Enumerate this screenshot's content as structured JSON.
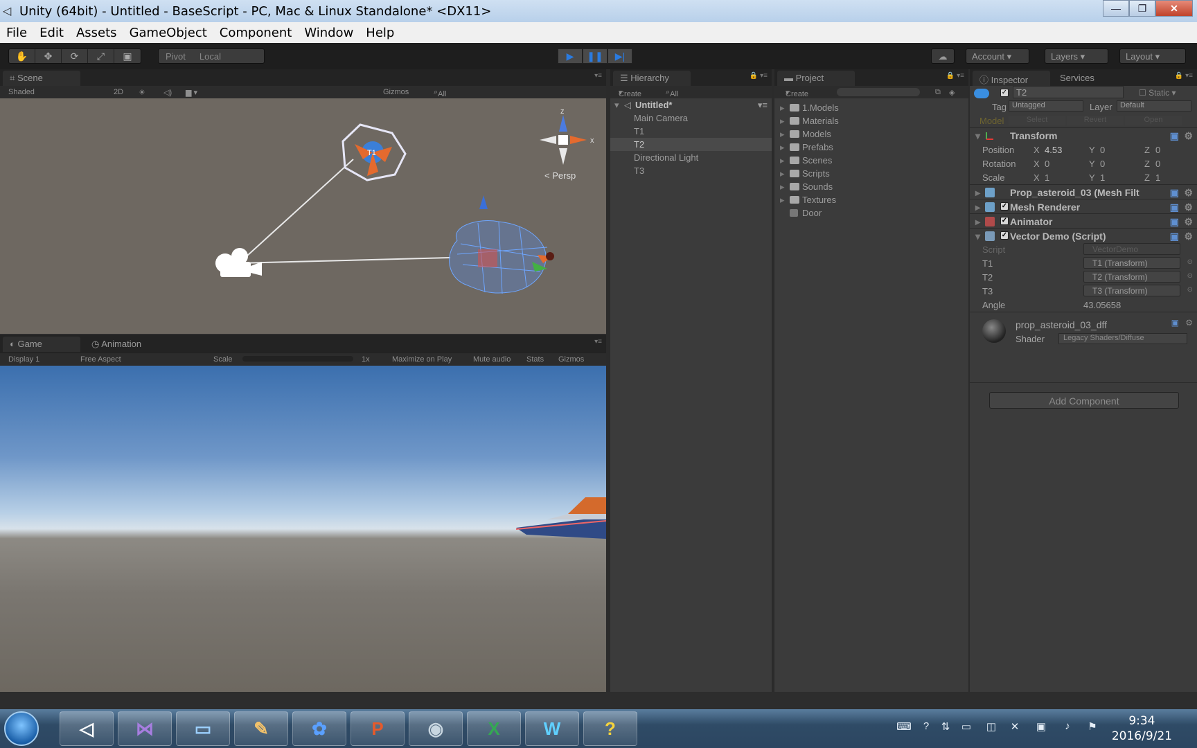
{
  "window": {
    "title": "Unity (64bit) - Untitled - BaseScript - PC, Mac & Linux Standalone* <DX11>",
    "minimize": "—",
    "maximize": "❐",
    "close": "✕"
  },
  "menu": [
    "File",
    "Edit",
    "Assets",
    "GameObject",
    "Component",
    "Window",
    "Help"
  ],
  "toolbar": {
    "pivot": "Pivot",
    "local": "Local",
    "account": "Account",
    "layers": "Layers",
    "layout": "Layout"
  },
  "scene": {
    "tab": "Scene",
    "shading": "Shaded",
    "mode_2d": "2D",
    "gizmos": "Gizmos",
    "search": "All",
    "persp": "Persp",
    "label_t1": "T1",
    "axis_z": "z",
    "axis_x": "x"
  },
  "game": {
    "tab": "Game",
    "tab2": "Animation",
    "display": "Display 1",
    "aspect": "Free Aspect",
    "scale_label": "Scale",
    "scale_value": "1x",
    "maximize": "Maximize on Play",
    "mute": "Mute audio",
    "stats": "Stats",
    "gizmos": "Gizmos"
  },
  "hierarchy": {
    "tab": "Hierarchy",
    "create": "Create",
    "search": "All",
    "scene_name": "Untitled*",
    "items": [
      "Main Camera",
      "T1",
      "T2",
      "Directional Light",
      "T3"
    ],
    "selected_index": 2
  },
  "project": {
    "tab": "Project",
    "create": "Create",
    "folders": [
      "1.Models",
      "Materials",
      "Models",
      "Prefabs",
      "Scenes",
      "Scripts",
      "Sounds",
      "Textures"
    ],
    "asset": "Door"
  },
  "inspector": {
    "tab": "Inspector",
    "tab2": "Services",
    "object_name": "T2",
    "static": "Static",
    "tag_label": "Tag",
    "tag_value": "Untagged",
    "layer_label": "Layer",
    "layer_value": "Default",
    "model_label": "Model",
    "model_select": "Select",
    "model_revert": "Revert",
    "model_open": "Open",
    "transform": {
      "title": "Transform",
      "position": {
        "label": "Position",
        "x": "4.53",
        "y": "0",
        "z": "0"
      },
      "rotation": {
        "label": "Rotation",
        "x": "0",
        "y": "0",
        "z": "0"
      },
      "scale": {
        "label": "Scale",
        "x": "1",
        "y": "1",
        "z": "1"
      }
    },
    "mesh_filter": "Prop_asteroid_03 (Mesh Filt",
    "mesh_renderer": "Mesh Renderer",
    "animator": "Animator",
    "script": {
      "title": "Vector Demo (Script)",
      "script_label": "Script",
      "script_value": "VectorDemo",
      "t1_label": "T1",
      "t1_value": "T1 (Transform)",
      "t2_label": "T2",
      "t2_value": "T2 (Transform)",
      "t3_label": "T3",
      "t3_value": "T3 (Transform)",
      "angle_label": "Angle",
      "angle_value": "43.05658"
    },
    "material": {
      "name": "prop_asteroid_03_dff",
      "shader_label": "Shader",
      "shader_value": "Legacy Shaders/Diffuse"
    },
    "add_component": "Add Component"
  },
  "taskbar": {
    "time": "9:34",
    "date": "2016/9/21"
  },
  "colors": {
    "editor_bg": "#3b3b3b",
    "scene_bg": "#6e6861",
    "play_blue": "#2a7be0",
    "selection": "#4a4a4a"
  }
}
